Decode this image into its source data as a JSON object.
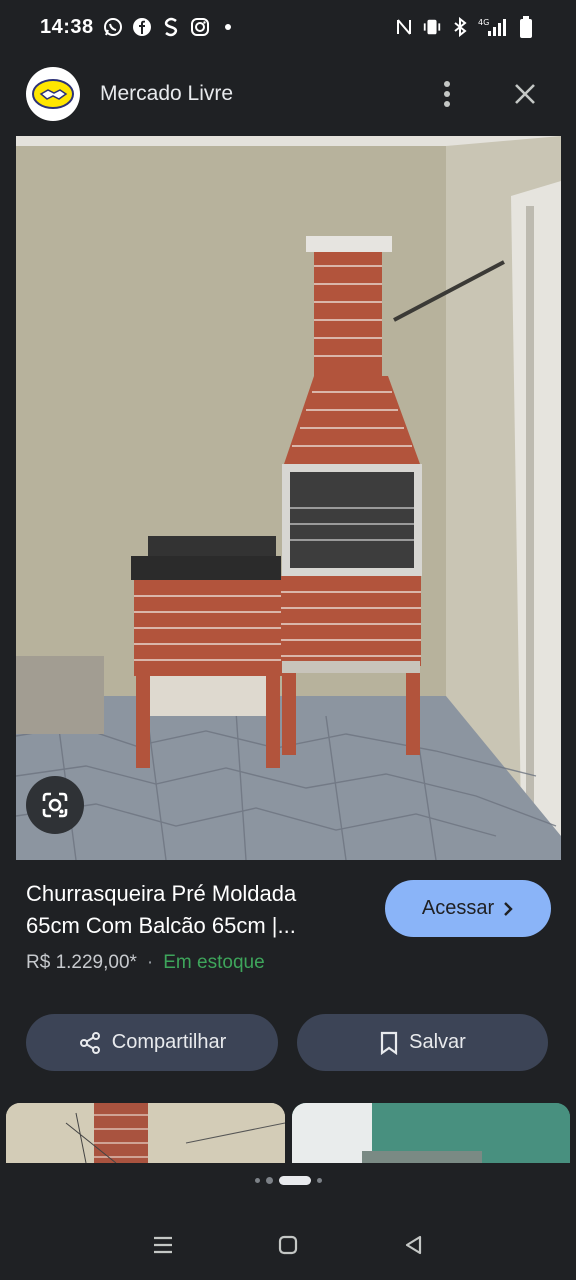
{
  "status_bar": {
    "time": "14:38",
    "left_icons": [
      "whatsapp-icon",
      "facebook-icon",
      "s-app-icon",
      "instagram-icon",
      "dot"
    ],
    "right_icons": [
      "nfc-icon",
      "vibrate-icon",
      "bluetooth-icon",
      "4g-signal-icon",
      "battery-icon"
    ]
  },
  "header": {
    "site_name": "Mercado Livre",
    "icons": [
      "more-vert-icon",
      "close-icon"
    ]
  },
  "product": {
    "title_line1": "Churrasqueira Pré Moldada",
    "title_line2": "65cm Com Balcão 65cm |...",
    "price": "R$ 1.229,00*",
    "separator": "·",
    "stock": "Em estoque",
    "visit_label": "Acessar"
  },
  "actions": {
    "share_label": "Compartilhar",
    "save_label": "Salvar"
  },
  "colors": {
    "background": "#1f2124",
    "accent": "#8ab4f8",
    "action_bg": "#3c4456",
    "stock": "#3ea55b"
  }
}
